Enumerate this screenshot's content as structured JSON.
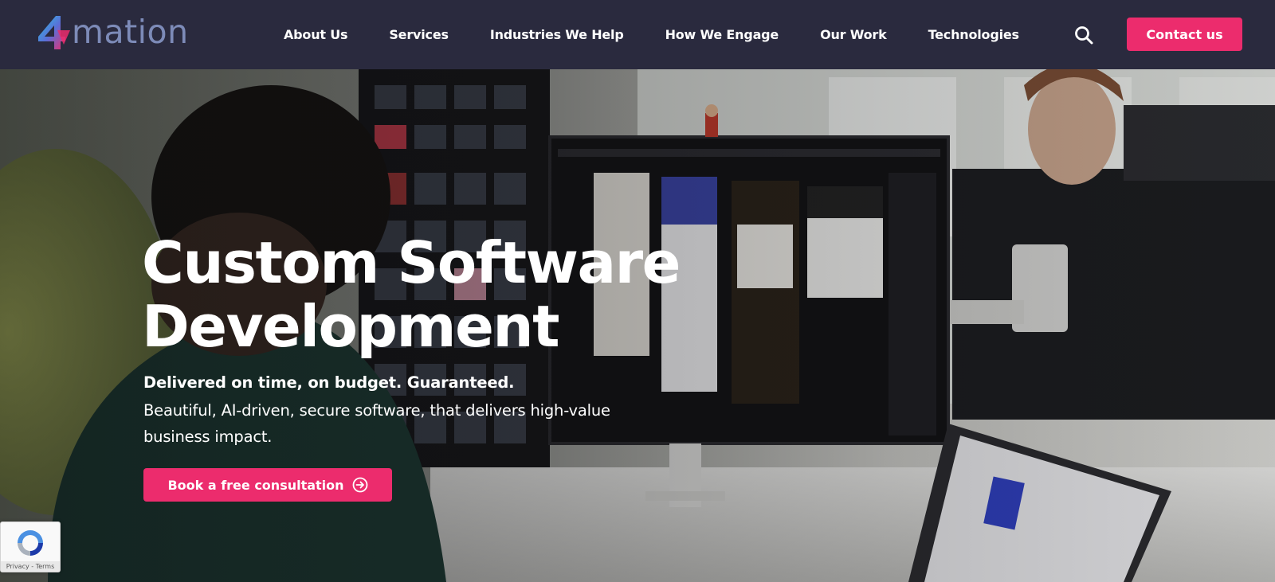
{
  "brand": {
    "logo_text": "mation",
    "logo_mark": "4",
    "accent_color": "#ec2c6d",
    "nav_bg": "#2a2a3e"
  },
  "nav": {
    "items": [
      {
        "label": "About Us"
      },
      {
        "label": "Services"
      },
      {
        "label": "Industries We Help"
      },
      {
        "label": "How We Engage"
      },
      {
        "label": "Our Work"
      },
      {
        "label": "Technologies"
      }
    ],
    "search_icon": "search-icon",
    "contact_label": "Contact us"
  },
  "hero": {
    "title_line1": "Custom Software",
    "title_line2": "Development",
    "subtitle_strong": "Delivered on time, on budget. Guaranteed.",
    "subtitle": "Beautiful, AI-driven, secure software, that delivers high-value business impact.",
    "cta_label": "Book a free consultation",
    "cta_icon": "circle-arrow-right-icon"
  },
  "recaptcha": {
    "label": "Privacy - Terms",
    "icon": "recaptcha-icon"
  }
}
